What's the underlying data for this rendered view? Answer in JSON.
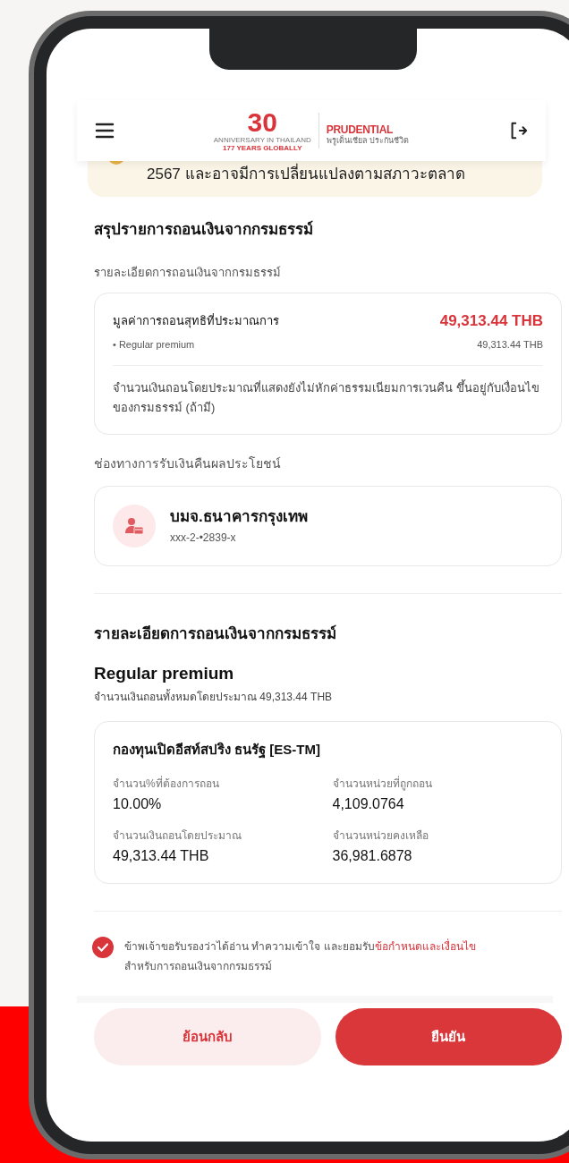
{
  "header": {
    "logo": {
      "number": "30",
      "caption": "ANNIVERSARY IN THAILAND",
      "years": "177 YEARS GLOBALLY",
      "brand": "PRUDENTIAL",
      "brand_thai": "พรูเด็นเชียล ประกันชีวิต"
    }
  },
  "notice": {
    "text": "2567 และอาจมีการเปลี่ยนแปลงตามสภาวะตลาด"
  },
  "summary": {
    "title": "สรุปรายการถอนเงินจากกรมธรรม์",
    "subtitle": "รายละเอียดการถอนเงินจากกรมธรรม์",
    "total_label": "มูลค่าการถอนสุทธิที่ประมาณการ",
    "total_value": "49,313.44 THB",
    "items": [
      {
        "bullet": "•",
        "label": "Regular premium",
        "value": "49,313.44 THB"
      }
    ],
    "note": "จำนวนเงินถอนโดยประมาณที่แสดงยังไม่หักค่าธรรมเนียมการเวนคืน ขึ้นอยู่กับเงื่อนไขของกรมธรรม์ (ถ้ามี)"
  },
  "payout": {
    "title": "ช่องทางการรับเงินคืนผลประโยชน์",
    "bank": "บมจ.ธนาคารกรุงเทพ",
    "account": "xxx-2-•2839-x"
  },
  "details": {
    "title": "รายละเอียดการถอนเงินจากกรมธรรม์",
    "premium_title": "Regular premium",
    "premium_total": "จำนวนเงินถอนทั้งหมดโดยประมาณ 49,313.44 THB",
    "fund": {
      "name": "กองทุนเปิดอีสท์สปริง ธนรัฐ [ES-TM]",
      "fields": [
        {
          "label": "จำนวน%ที่ต้องการถอน",
          "value": "10.00%"
        },
        {
          "label": "จำนวนหน่วยที่ถูกถอน",
          "value": "4,109.0764"
        },
        {
          "label": "จำนวนเงินถอนโดยประมาณ",
          "value": "49,313.44 THB"
        },
        {
          "label": "จำนวนหน่วยคงเหลือ",
          "value": "36,981.6878"
        }
      ]
    }
  },
  "consent": {
    "checked": true,
    "text": "ข้าพเจ้าขอรับรองว่าได้อ่าน ทำความเข้าใจ และยอมรับ",
    "link": "ข้อกำหนดและเงื่อนไข",
    "text_after": "สำหรับการถอนเงินจากกรมธรรม์"
  },
  "buttons": {
    "back": "ย้อนกลับ",
    "confirm": "ยืนยัน"
  }
}
